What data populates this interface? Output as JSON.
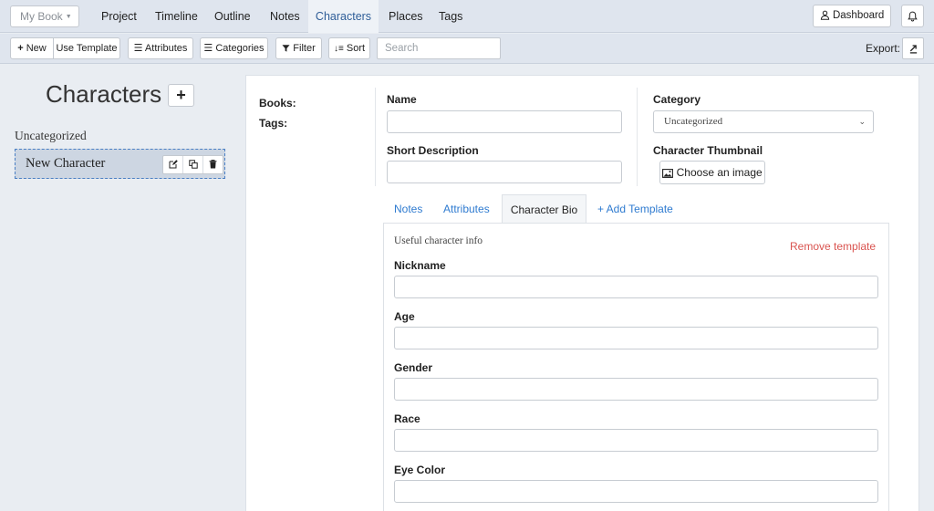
{
  "topnav": {
    "book_label": "My Book",
    "tabs": [
      "Project",
      "Timeline",
      "Outline",
      "Notes",
      "Characters",
      "Places",
      "Tags"
    ],
    "active_tab": "Characters",
    "dashboard_label": "Dashboard"
  },
  "toolbar": {
    "new_label": "New",
    "use_template_label": "Use Template",
    "attributes_label": "Attributes",
    "categories_label": "Categories",
    "filter_label": "Filter",
    "sort_label": "Sort",
    "search_placeholder": "Search",
    "export_label": "Export:"
  },
  "sidebar": {
    "title": "Characters",
    "category": "Uncategorized",
    "items": [
      {
        "name": "New Character"
      }
    ]
  },
  "detail": {
    "books_label": "Books:",
    "tags_label": "Tags:",
    "name_label": "Name",
    "name_value": "",
    "short_description_label": "Short Description",
    "short_description_value": "",
    "category_label": "Category",
    "category_value": "Uncategorized",
    "thumbnail_label": "Character Thumbnail",
    "choose_image_label": "Choose an image",
    "tabs": [
      "Notes",
      "Attributes",
      "Character Bio",
      "+ Add Template"
    ],
    "active_tab": "Character Bio",
    "template_description": "Useful character info",
    "remove_template_label": "Remove template",
    "fields": [
      {
        "label": "Nickname",
        "value": ""
      },
      {
        "label": "Age",
        "value": ""
      },
      {
        "label": "Gender",
        "value": ""
      },
      {
        "label": "Race",
        "value": ""
      },
      {
        "label": "Eye Color",
        "value": ""
      }
    ]
  },
  "colors": {
    "accent": "#2f7bd0",
    "nav_active_text": "#2f5e98",
    "danger": "#d9534f",
    "selected_item_bg": "#cdd6e2"
  }
}
